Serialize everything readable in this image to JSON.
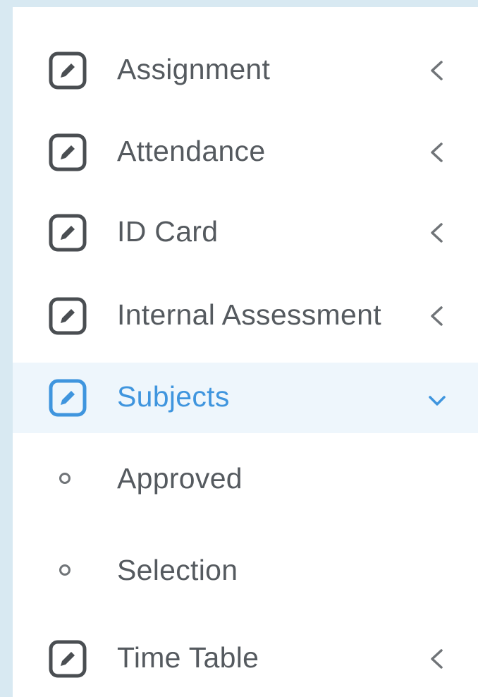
{
  "sidebar": {
    "items": [
      {
        "label": "Assignment",
        "icon": "edit-icon",
        "expanded": false
      },
      {
        "label": "Attendance",
        "icon": "edit-icon",
        "expanded": false
      },
      {
        "label": "ID Card",
        "icon": "edit-icon",
        "expanded": false
      },
      {
        "label": "Internal Assessment",
        "icon": "edit-icon",
        "expanded": false
      },
      {
        "label": "Subjects",
        "icon": "edit-icon",
        "expanded": true,
        "active": true,
        "children": [
          {
            "label": "Approved",
            "icon": "circle-bullet-icon"
          },
          {
            "label": "Selection",
            "icon": "circle-bullet-icon"
          }
        ]
      },
      {
        "label": "Time Table",
        "icon": "edit-icon",
        "expanded": false
      }
    ]
  },
  "colors": {
    "background": "#d8e9f2",
    "panel": "#ffffff",
    "text": "#555a5f",
    "active_text": "#3f95de",
    "active_background": "#eef6fc",
    "icon": "#4a4e52"
  }
}
